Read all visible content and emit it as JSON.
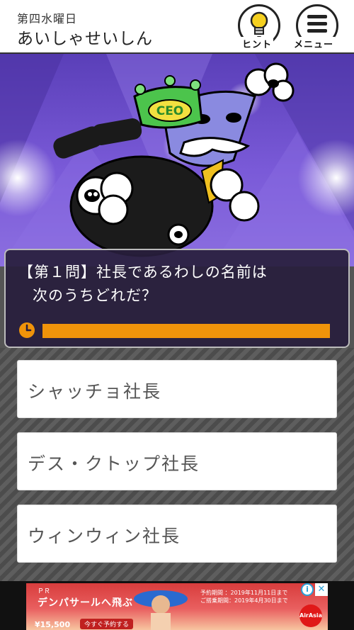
{
  "header": {
    "subtitle": "第四水曜日",
    "title": "あいしゃせいしん",
    "hint_label": "ヒント",
    "menu_label": "メニュー",
    "hint_icon": "lightbulb-icon",
    "menu_icon": "hamburger-menu-icon"
  },
  "scene": {
    "crown_text": "CEO",
    "character": "CEO character with crown and mustache"
  },
  "question": {
    "line1": "【第１問】社長であるわしの名前は",
    "line2": "次のうちどれだ？",
    "timer_icon": "clock-icon",
    "timer_remaining": 1.0,
    "timer_color": "#f0940a"
  },
  "answers": [
    {
      "label": "シャッチョ社長"
    },
    {
      "label": "デス・クトップ社長"
    },
    {
      "label": "ウィンウィン社長"
    }
  ],
  "ad": {
    "small_text": "ＰＲ",
    "headline": "デンパサールへ飛ぶ",
    "price": "¥15,500",
    "cta": "今すぐ予約する",
    "fine_line1": "予約期間 ：2019年11月11日まで",
    "fine_line2": "ご搭乗期間：2019年4月30日まで",
    "logo": "AirAsia",
    "info_icon": "i",
    "close_icon": "✕"
  },
  "colors": {
    "accent": "#f0940a",
    "scene_bg": "#6a4fd0",
    "question_bg": "#281e3c"
  }
}
